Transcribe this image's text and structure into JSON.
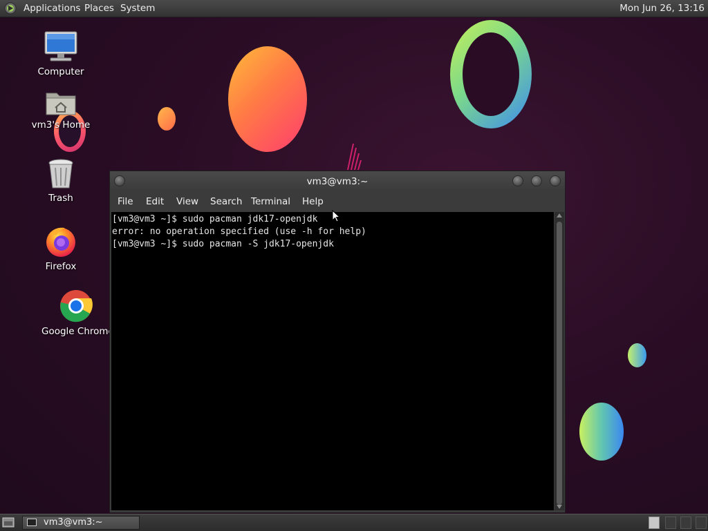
{
  "top_panel": {
    "menu": [
      "Applications",
      "Places",
      "System"
    ],
    "clock": "Mon Jun 26, 13:16"
  },
  "desktop": {
    "icons": [
      {
        "label": "Computer",
        "icon": "computer-icon"
      },
      {
        "label": "vm3's Home",
        "icon": "home-folder-icon"
      },
      {
        "label": "Trash",
        "icon": "trash-icon"
      },
      {
        "label": "Firefox",
        "icon": "firefox-icon"
      },
      {
        "label": "Google Chrome",
        "icon": "chrome-icon"
      }
    ]
  },
  "terminal": {
    "title": "vm3@vm3:~",
    "menu": [
      "File",
      "Edit",
      "View",
      "Search",
      "Terminal",
      "Help"
    ],
    "lines": [
      "[vm3@vm3 ~]$ sudo pacman jdk17-openjdk",
      "error: no operation specified (use -h for help)",
      "[vm3@vm3 ~]$ sudo pacman -S jdk17-openjdk"
    ]
  },
  "taskbar": {
    "tasks": [
      {
        "label": "vm3@vm3:~",
        "icon": "terminal-icon"
      }
    ]
  },
  "colors": {
    "panel": "#3b3b3b",
    "terminal_bg": "#000000",
    "terminal_fg": "#e6e6e6",
    "wallpaper": "#2a0d25"
  }
}
